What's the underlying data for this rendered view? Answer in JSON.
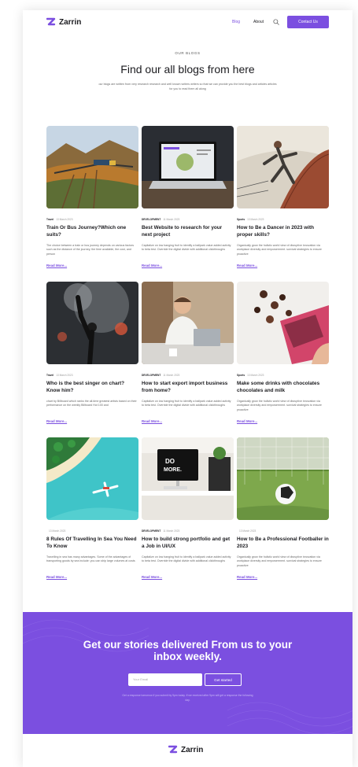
{
  "brand": {
    "name": "Zarrin",
    "accent": "#7b4fe0"
  },
  "nav": {
    "blog": "Blog",
    "about": "About",
    "contact": "Contact Us"
  },
  "hero": {
    "eyebrow": "OUR BLOGS",
    "title": "Find our all blogs from here",
    "subtitle": "our blogs are written from very research research and well known writers writers so that  we can provide you the best blogs and articles articles for you to read them all along"
  },
  "cards": [
    {
      "category": "Travel",
      "date": "13 March 2023",
      "title": "Train Or Bus Journey?Which one suits?",
      "excerpt": "The choice between a train or bus journey depends on various factors such as the distance of the journey, the time available, the cost, and person",
      "read": "Read More..."
    },
    {
      "category": "DEVELOPMENT",
      "date": "11 March 2023",
      "title": "Best Website to research for your next project",
      "excerpt": "Capitalize on low hanging fruit to identify a ballpark value added activity to beta test. Override the digital divide with additional clickthroughs",
      "read": "Read More..."
    },
    {
      "category": "Sports",
      "date": "13 March 2023",
      "title": "How to Be a Dancer in 2023 with proper skills?",
      "excerpt": "Organically grow the holistic world view of disruptive innovation via workplace diversity and empowerment. survival strategies to ensure proactive",
      "read": "Read More..."
    },
    {
      "category": "Travel",
      "date": "13 March 2023",
      "title": "Who is the best singer on chart? Know him?",
      "excerpt": "chart by Billboard which ranks the all-time greatest artists based on their performance on the weekly Billboard Hot 100 and",
      "read": "Read More..."
    },
    {
      "category": "DEVELOPMENT",
      "date": "11 March 2023",
      "title": "How to start export import business from home?",
      "excerpt": "Capitalize on low hanging fruit to identify a ballpark value added activity to beta test. Override the digital divide with additional clickthroughs",
      "read": "Read More..."
    },
    {
      "category": "Sports",
      "date": "13 March 2023",
      "title": "Make some drinks with chocolates chocolates and milk",
      "excerpt": "Organically grow the holistic world view of disruptive innovation via workplace diversity and empowerment. survival strategies to ensure proactive",
      "read": "Read More..."
    },
    {
      "category": "",
      "date": "13 March 2023",
      "title": "8 Rules Of Travelling In Sea You Need To Know",
      "excerpt": "Travelling in sea has many advantages. Some of the advantages of transporting goods by sea include: you can ship large volumes at costs",
      "read": "Read More..."
    },
    {
      "category": "DEVELOPMENT",
      "date": "11 March 2023",
      "title": "How to build strong portfolio and get a Job in UI/UX",
      "excerpt": "Capitalize on low hanging fruit to identify a ballpark value added activity to beta test. Override the digital divide with additional clickthroughs",
      "read": "Read More..."
    },
    {
      "category": "",
      "date": "13 March 2023",
      "title": "How to Be a Professional Footballer in 2023",
      "excerpt": "Organically grow the holistic world view of disruptive innovation via workplace diversity and empowerment. survival strategies to ensure proactive",
      "read": "Read More..."
    }
  ],
  "newsletter": {
    "title": "Get our stories delivered From us to your inbox weekly.",
    "placeholder": "Your Email",
    "button": "Get started",
    "note": "Get a response tomorrow if you submit by 9pm today. If we received after 9pm will get a response the following day."
  }
}
